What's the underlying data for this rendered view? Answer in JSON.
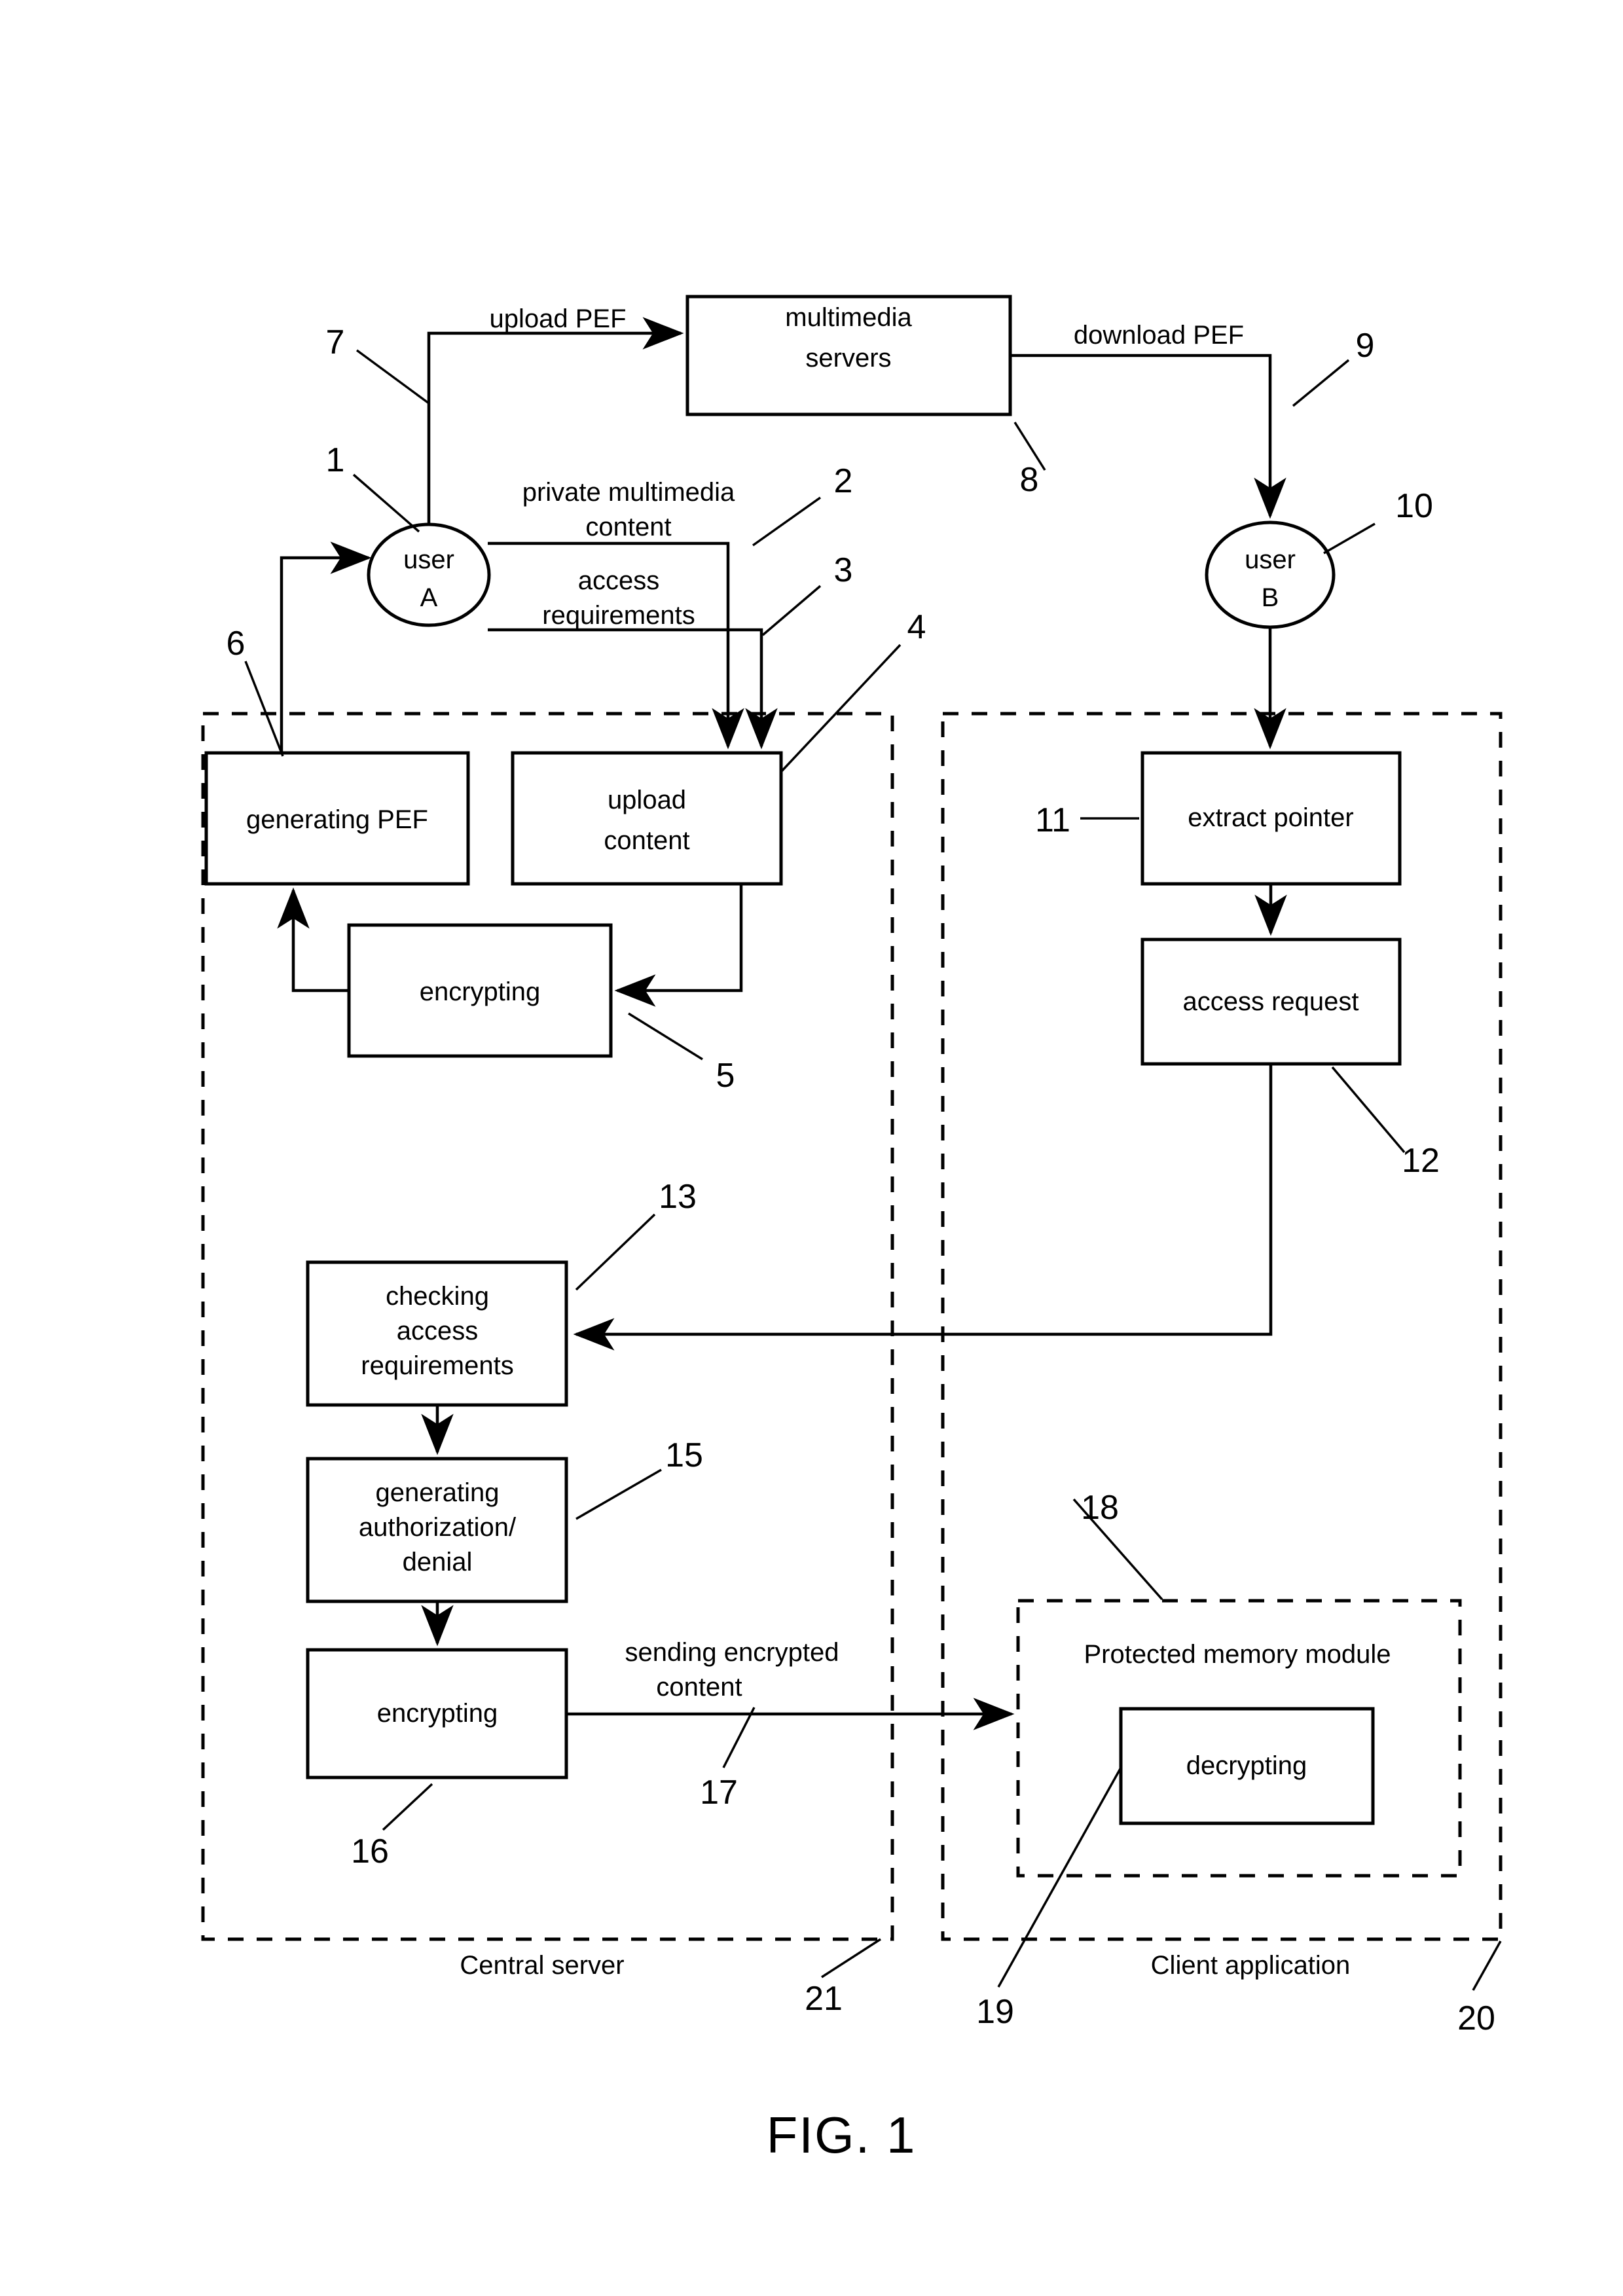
{
  "figure": {
    "title": "FIG. 1",
    "background_color": "#ffffff",
    "stroke_color": "#000000"
  },
  "actors": [
    {
      "id": "user-a",
      "line1": "user",
      "line2": "A",
      "ref": "1"
    },
    {
      "id": "user-b",
      "line1": "user",
      "line2": "B",
      "ref": "10"
    }
  ],
  "boxes": {
    "multimedia_servers": {
      "line1": "multimedia",
      "line2": "servers",
      "ref": "8"
    },
    "generating_pef": {
      "line1": "generating PEF",
      "line2": "",
      "ref": "6"
    },
    "upload_content": {
      "line1": "upload",
      "line2": "content",
      "ref": "4"
    },
    "encrypting_upload": {
      "line1": "encrypting",
      "line2": "",
      "ref": "5"
    },
    "checking_access": {
      "line1": "checking",
      "line2": "access",
      "line3": "requirements",
      "ref": "13"
    },
    "generating_auth": {
      "line1": "generating",
      "line2": "authorization/",
      "line3": "denial",
      "ref": "15"
    },
    "encrypting_send": {
      "line1": "encrypting",
      "line2": "",
      "ref": "16"
    },
    "extract_pointer": {
      "line1": "extract pointer",
      "line2": "",
      "ref": "11"
    },
    "access_request": {
      "line1": "access request",
      "line2": "",
      "ref": "12"
    },
    "decrypting": {
      "line1": "decrypting",
      "line2": "",
      "ref": "19"
    }
  },
  "containers": {
    "central_server": {
      "label": "Central server",
      "ref": "21"
    },
    "client_app": {
      "label": "Client application",
      "ref": "20"
    },
    "protected_memory": {
      "label": "Protected memory module",
      "ref": "18"
    }
  },
  "edge_labels": {
    "upload_pef": {
      "text": "upload PEF",
      "ref": "7"
    },
    "download_pef": {
      "text": "download PEF",
      "ref": "9"
    },
    "private_content_l1": "private multimedia",
    "private_content_l2": "content",
    "private_content_ref": "2",
    "access_req_l1": "access",
    "access_req_l2": "requirements",
    "access_req_ref": "3",
    "sending_l1": "sending encrypted",
    "sending_l2": "content",
    "sending_ref": "17"
  },
  "reference_numerals": [
    "1",
    "2",
    "3",
    "4",
    "5",
    "6",
    "7",
    "8",
    "9",
    "10",
    "11",
    "12",
    "13",
    "15",
    "16",
    "17",
    "18",
    "19",
    "20",
    "21"
  ]
}
